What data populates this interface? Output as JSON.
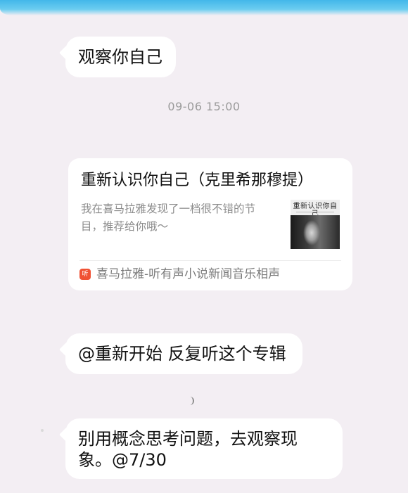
{
  "messages": [
    {
      "text": "观察你自己"
    },
    {
      "timestamp": "09-06 15:00"
    },
    {
      "card": {
        "title": "重新认识你自己（克里希那穆提）",
        "description": "我在喜马拉雅发现了一档很不错的节目，推荐给你哦～",
        "thumbnail_title": "重新认识你自己",
        "source_icon": "听",
        "source_name": "喜马拉雅-听有声小说新闻音乐相声"
      }
    },
    {
      "text": "@重新开始 反复听这个专辑"
    },
    {
      "lines": [
        "别用概念思考问题，去观察现",
        "象。@7/30"
      ]
    }
  ],
  "colors": {
    "background": "#f3eef3",
    "bubble": "#ffffff",
    "muted_text": "#8c8c8c",
    "timestamp_text": "#9a9a9a",
    "source_icon": "#f05133",
    "top_strip": "#42b7ea"
  },
  "icons": {
    "source": "ximalaya-app-icon",
    "loading": "loading-spinner-icon"
  }
}
